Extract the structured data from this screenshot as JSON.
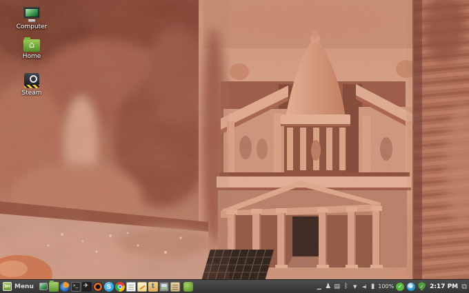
{
  "desktop": {
    "wallpaper": {
      "description": "Aerial photo of the Treasury (Al-Khazneh) facade carved into red sandstone cliffs at Petra"
    },
    "icons": [
      {
        "name": "computer-desktop-icon",
        "label": "Computer"
      },
      {
        "name": "home-desktop-icon",
        "label": "Home"
      },
      {
        "name": "steam-desktop-icon",
        "label": "Steam"
      }
    ]
  },
  "taskbar": {
    "menu": {
      "label": "Menu",
      "icon": "mint-menu-icon"
    },
    "launchers": [
      {
        "icon": "show-desktop-icon"
      },
      {
        "icon": "file-manager-icon"
      },
      {
        "icon": "firefox-icon"
      },
      {
        "icon": "terminal-icon"
      },
      {
        "icon": "bird-app-icon"
      },
      {
        "icon": "camera-lens-icon"
      },
      {
        "icon": "skype-icon"
      },
      {
        "icon": "chrome-icon"
      },
      {
        "icon": "text-editor-icon"
      },
      {
        "icon": "notes-icon"
      },
      {
        "icon": "tan-t-app-icon"
      },
      {
        "icon": "image-viewer-icon"
      },
      {
        "icon": "scroll-app-icon"
      },
      {
        "icon": "green-app-icon"
      }
    ],
    "tray": [
      {
        "icon": "minimized-window-icon",
        "glyph": "▁"
      },
      {
        "icon": "user-applet-icon",
        "glyph": "♟"
      },
      {
        "icon": "clipboard-icon",
        "glyph": "▤"
      },
      {
        "icon": "bluetooth-icon",
        "glyph": "ᛒ"
      },
      {
        "icon": "network-icon",
        "glyph": "▼"
      },
      {
        "icon": "volume-icon",
        "glyph": "◄)"
      },
      {
        "icon": "battery-icon",
        "glyph": "▮"
      },
      {
        "icon": "battery-percent",
        "label": "100%"
      },
      {
        "icon": "update-manager-icon",
        "glyph": "✓"
      },
      {
        "icon": "sync-icon",
        "glyph": "●"
      },
      {
        "icon": "firewall-shield-icon",
        "glyph": "✓"
      }
    ],
    "clock": "2:17 PM",
    "window_stack_glyph": "⧉",
    "panel_color": "#3c3c3c"
  }
}
